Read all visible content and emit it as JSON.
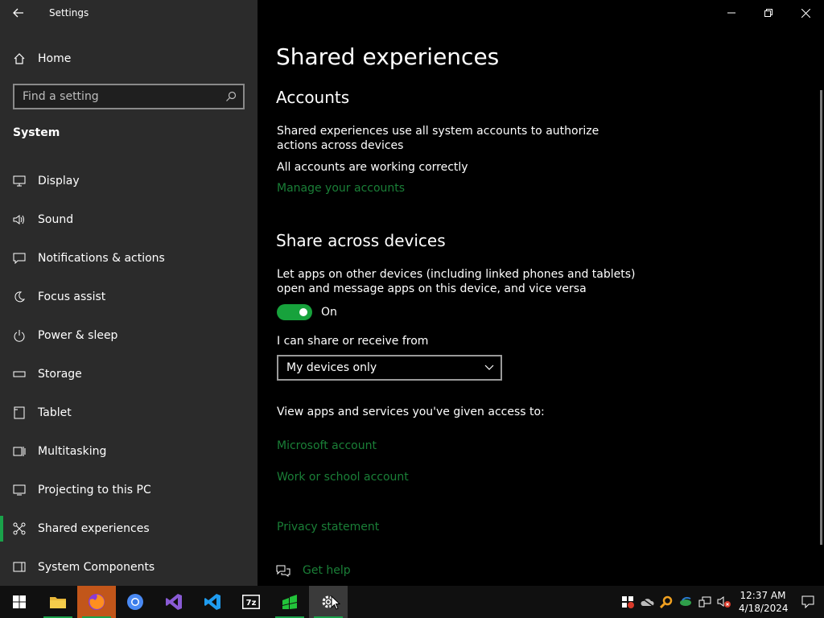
{
  "window": {
    "app_title": "Settings"
  },
  "sidebar": {
    "home_label": "Home",
    "search_placeholder": "Find a setting",
    "section_title": "System",
    "items": [
      {
        "label": "Display",
        "icon": "display-icon"
      },
      {
        "label": "Sound",
        "icon": "sound-icon"
      },
      {
        "label": "Notifications & actions",
        "icon": "notifications-icon"
      },
      {
        "label": "Focus assist",
        "icon": "moon-icon"
      },
      {
        "label": "Power & sleep",
        "icon": "power-icon"
      },
      {
        "label": "Storage",
        "icon": "storage-icon"
      },
      {
        "label": "Tablet",
        "icon": "tablet-icon"
      },
      {
        "label": "Multitasking",
        "icon": "multitasking-icon"
      },
      {
        "label": "Projecting to this PC",
        "icon": "projecting-icon"
      },
      {
        "label": "Shared experiences",
        "icon": "shared-experiences-icon",
        "active": true
      },
      {
        "label": "System Components",
        "icon": "system-components-icon"
      }
    ]
  },
  "main": {
    "page_title": "Shared experiences",
    "accounts": {
      "heading": "Accounts",
      "description": "Shared experiences use all system accounts to authorize actions across devices",
      "status": "All accounts are working correctly",
      "manage_link": "Manage your accounts"
    },
    "share": {
      "heading": "Share across devices",
      "description": "Let apps on other devices (including linked phones and tablets) open and message apps on this device, and vice versa",
      "toggle_state": "On",
      "share_label": "I can share or receive from",
      "dropdown_value": "My devices only",
      "view_apps_text": "View apps and services you've given access to:",
      "microsoft_link": "Microsoft account",
      "work_link": "Work or school account"
    },
    "privacy_link": "Privacy statement",
    "help_link": "Get help"
  },
  "taskbar": {
    "time": "12:37 AM",
    "date": "4/18/2024"
  },
  "colors": {
    "accent": "#1aa24a",
    "link": "#1a7f37",
    "sidebar_bg": "#2b2b2b"
  }
}
